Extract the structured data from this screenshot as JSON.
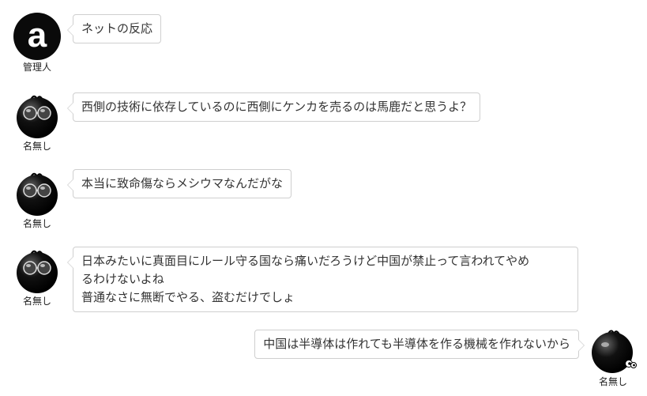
{
  "messages": [
    {
      "author": "管理人",
      "avatar": "admin-a-icon",
      "side": "left",
      "lines": [
        "ネットの反応"
      ]
    },
    {
      "author": "名無し",
      "avatar": "black-ball-sunglasses-icon",
      "side": "left",
      "lines": [
        "西側の技術に依存しているのに西側にケンカを売るのは馬鹿だと思うよ？"
      ]
    },
    {
      "author": "名無し",
      "avatar": "black-ball-sunglasses-icon",
      "side": "left",
      "lines": [
        "本当に致命傷ならメシウマなんだがな"
      ]
    },
    {
      "author": "名無し",
      "avatar": "black-ball-sunglasses-icon",
      "side": "left",
      "lines": [
        "日本みたいに真面目にルール守る国なら痛いだろうけど中国が禁止って言われてやめ",
        "るわけないよね",
        "普通なさに無断でやる、盗むだけでしょ"
      ]
    },
    {
      "author": "名無し",
      "avatar": "black-ball-eyes-icon",
      "side": "right",
      "lines": [
        "中国は半導体は作れても半導体を作る機械を作れないから"
      ]
    }
  ]
}
